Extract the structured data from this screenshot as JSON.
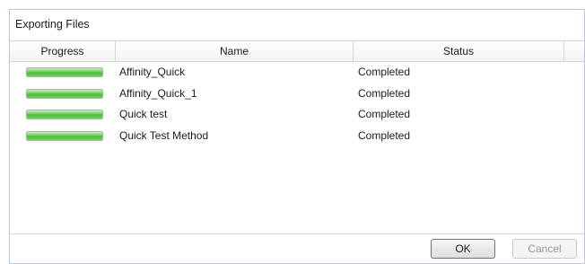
{
  "window": {
    "title": "Exporting Files"
  },
  "grid": {
    "columns": {
      "progress": "Progress",
      "name": "Name",
      "status": "Status"
    },
    "rows": [
      {
        "progress_fraction": 1.0,
        "name": "Affinity_Quick",
        "status": "Completed"
      },
      {
        "progress_fraction": 1.0,
        "name": "Affinity_Quick_1",
        "status": "Completed"
      },
      {
        "progress_fraction": 1.0,
        "name": "Quick test",
        "status": "Completed"
      },
      {
        "progress_fraction": 1.0,
        "name": "Quick Test Method",
        "status": "Completed"
      }
    ]
  },
  "buttons": {
    "ok_label": "OK",
    "cancel_label": "Cancel",
    "cancel_enabled": false
  },
  "colors": {
    "progress_fill": "#4cb93b",
    "window_border": "#b9c7d9"
  }
}
